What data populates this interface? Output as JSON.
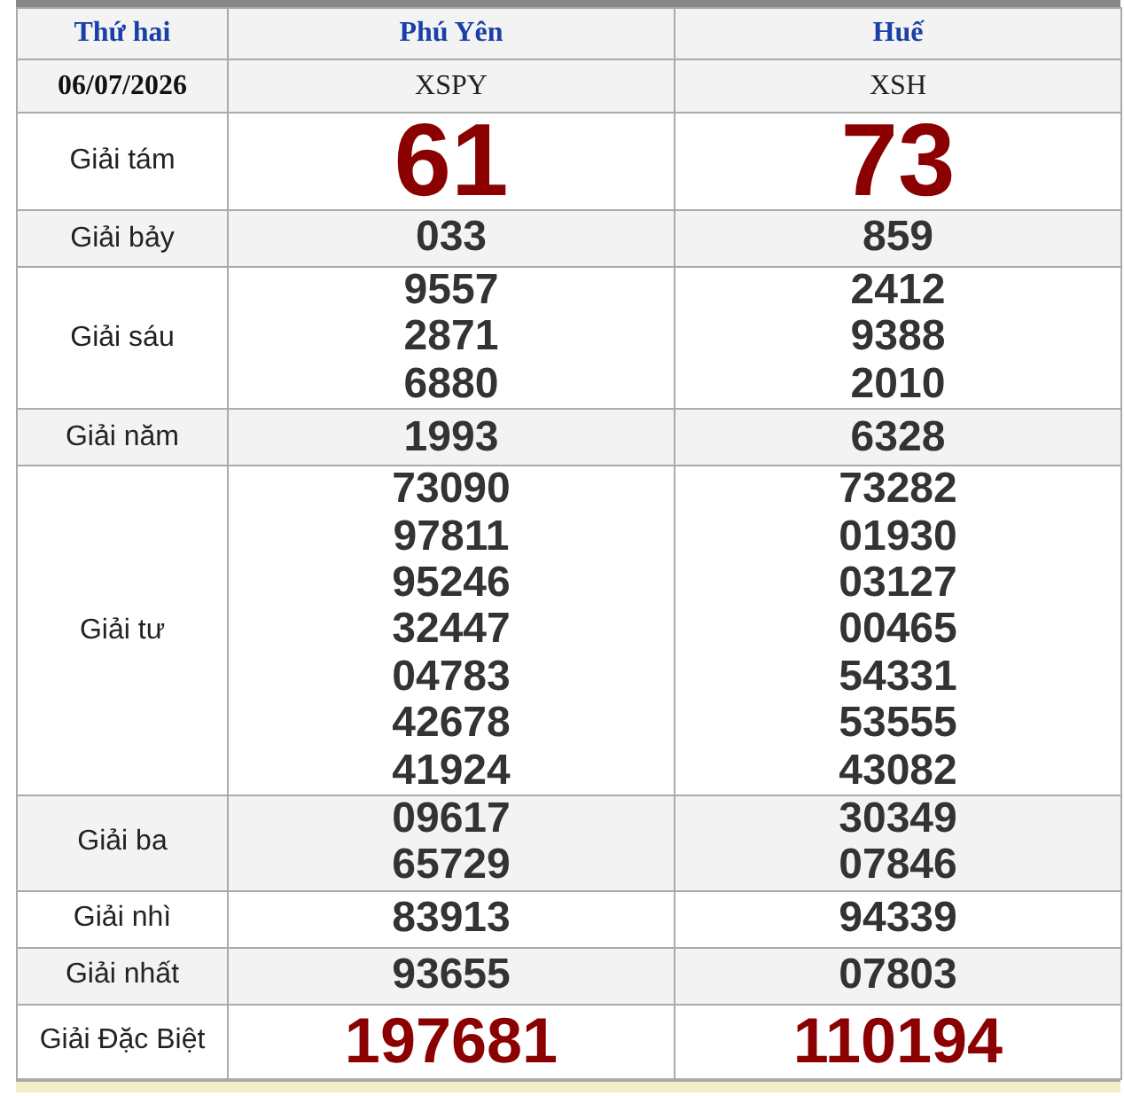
{
  "header": {
    "day": "Thứ hai",
    "provinces": [
      "Phú Yên",
      "Huế"
    ]
  },
  "date_row": {
    "date": "06/07/2026",
    "codes": [
      "XSPY",
      "XSH"
    ]
  },
  "prizes": [
    {
      "label": "Giải tám",
      "kind": "big",
      "results": [
        [
          "61"
        ],
        [
          "73"
        ]
      ]
    },
    {
      "label": "Giải bảy",
      "kind": "normal",
      "results": [
        [
          "033"
        ],
        [
          "859"
        ]
      ]
    },
    {
      "label": "Giải sáu",
      "kind": "normal",
      "results": [
        [
          "9557",
          "2871",
          "6880"
        ],
        [
          "2412",
          "9388",
          "2010"
        ]
      ]
    },
    {
      "label": "Giải năm",
      "kind": "normal",
      "results": [
        [
          "1993"
        ],
        [
          "6328"
        ]
      ]
    },
    {
      "label": "Giải tư",
      "kind": "normal",
      "results": [
        [
          "73090",
          "97811",
          "95246",
          "32447",
          "04783",
          "42678",
          "41924"
        ],
        [
          "73282",
          "01930",
          "03127",
          "00465",
          "54331",
          "53555",
          "43082"
        ]
      ]
    },
    {
      "label": "Giải ba",
      "kind": "normal",
      "results": [
        [
          "09617",
          "65729"
        ],
        [
          "30349",
          "07846"
        ]
      ]
    },
    {
      "label": "Giải nhì",
      "kind": "normal",
      "results": [
        [
          "83913"
        ],
        [
          "94339"
        ]
      ]
    },
    {
      "label": "Giải nhất",
      "kind": "normal",
      "results": [
        [
          "93655"
        ],
        [
          "07803"
        ]
      ]
    },
    {
      "label": "Giải Đặc Biệt",
      "kind": "special",
      "results": [
        [
          "197681"
        ],
        [
          "110194"
        ]
      ]
    }
  ]
}
